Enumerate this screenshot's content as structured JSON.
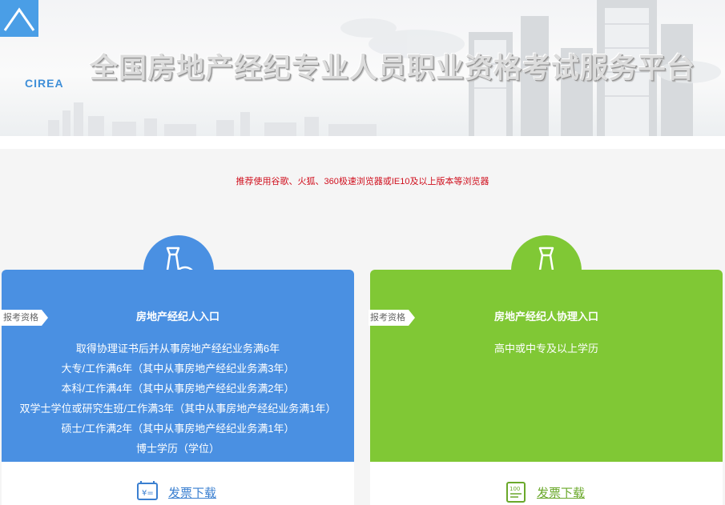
{
  "header": {
    "logo_text": "CIREA",
    "title": "全国房地产经纪专业人员职业资格考试服务平台"
  },
  "notice": "推荐使用谷歌、火狐、360极速浏览器或IE10及以上版本等浏览器",
  "cards": [
    {
      "title": "房地产经纪人入口",
      "tag": "报考资格",
      "requirements": [
        "取得协理证书后并从事房地产经纪业务满6年",
        "大专/工作满6年（其中从事房地产经纪业务满3年）",
        "本科/工作满4年（其中从事房地产经纪业务满2年）",
        "双学士学位或研究生班/工作满3年（其中从事房地产经纪业务满1年）",
        "硕士/工作满2年（其中从事房地产经纪业务满1年）",
        "博士学历（学位）"
      ],
      "download_label": "发票下载",
      "color": "#4a90e2"
    },
    {
      "title": "房地产经纪人协理入口",
      "tag": "报考资格",
      "requirements": [
        "高中或中专及以上学历"
      ],
      "download_label": "发票下载",
      "color": "#80c835"
    }
  ]
}
